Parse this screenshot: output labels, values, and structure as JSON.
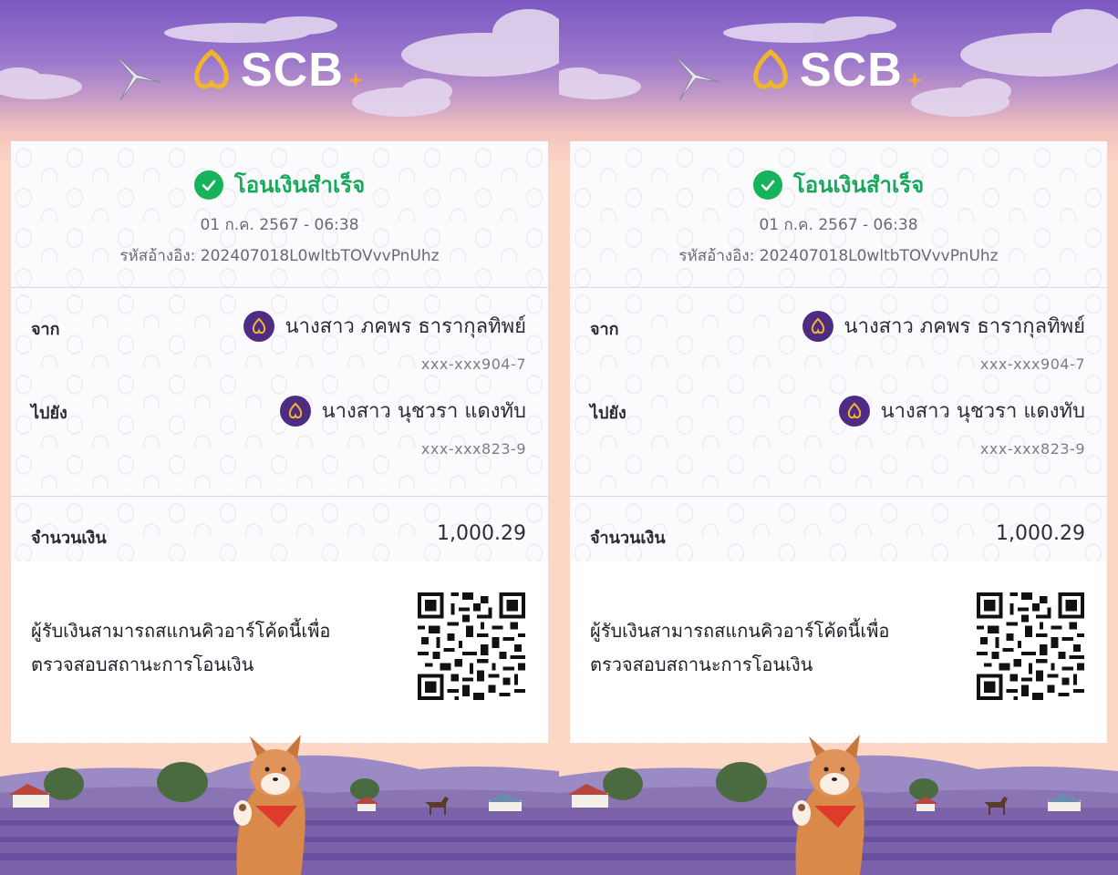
{
  "brand": {
    "name": "SCB"
  },
  "slips": [
    {
      "status_title": "โอนเงินสำเร็จ",
      "datetime": "01 ก.ค. 2567 - 06:38",
      "reference": "รหัสอ้างอิง: 202407018L0wltbTOVvvPnUhz",
      "from_label": "จาก",
      "from_name": "นางสาว ภคพร ธารากุลทิพย์",
      "from_account": "xxx-xxx904-7",
      "to_label": "ไปยัง",
      "to_name": "นางสาว นุชวรา แดงทับ",
      "to_account": "xxx-xxx823-9",
      "amount_label": "จำนวนเงิน",
      "amount_value": "1,000.29",
      "qr_note": "ผู้รับเงินสามารถสแกนคิวอาร์โค้ดนี้เพื่อ ตรวจสอบสถานะการโอนเงิน"
    },
    {
      "status_title": "โอนเงินสำเร็จ",
      "datetime": "01 ก.ค. 2567 - 06:38",
      "reference": "รหัสอ้างอิง: 202407018L0wltbTOVvvPnUhz",
      "from_label": "จาก",
      "from_name": "นางสาว ภคพร ธารากุลทิพย์",
      "from_account": "xxx-xxx904-7",
      "to_label": "ไปยัง",
      "to_name": "นางสาว นุชวรา แดงทับ",
      "to_account": "xxx-xxx823-9",
      "amount_label": "จำนวนเงิน",
      "amount_value": "1,000.29",
      "qr_note": "ผู้รับเงินสามารถสแกนคิวอาร์โค้ดนี้เพื่อ ตรวจสอบสถานะการโอนเงิน"
    }
  ],
  "icons": {
    "brand_mark": "scb-logo-icon",
    "status": "check-circle-icon",
    "bank": "scb-bank-icon",
    "qr": "qr-code-icon"
  },
  "colors": {
    "brand_purple": "#4f2c84",
    "success_green": "#17b35a",
    "brand_gold": "#f1b52b"
  }
}
